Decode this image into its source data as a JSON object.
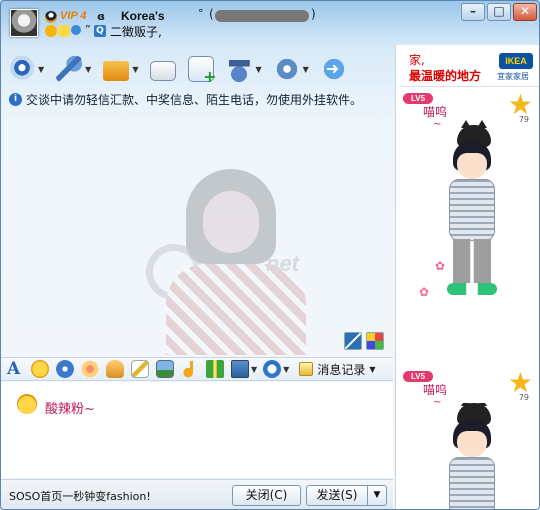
{
  "window": {
    "vip_label": "VIP 4",
    "contact_name": "Korea's",
    "name_symbol": "°",
    "qq_number_masked": "██████",
    "paren_open": "(",
    "paren_close": ")",
    "kb_glyph": "ɞ",
    "signature_quote": "”",
    "signature_icon_text": "Q",
    "signature": "二徵贩子,",
    "controls": {
      "minimize": "–",
      "maximize": "□",
      "close": "✕"
    }
  },
  "toolbar": {
    "items": [
      {
        "icon": "camera-icon"
      },
      {
        "icon": "microphone-icon"
      },
      {
        "icon": "folder-icon"
      },
      {
        "icon": "mail-icon"
      },
      {
        "icon": "add-document-icon"
      },
      {
        "icon": "graduation-cap-icon"
      },
      {
        "icon": "gear-icon"
      },
      {
        "icon": "share-arrow-icon"
      }
    ],
    "caret": "▼"
  },
  "notice": {
    "icon": "i",
    "text": "交谈中请勿轻信汇款、中奖信息、陌生电话，勿使用外挂软件。"
  },
  "history": {
    "ghost_brand": "net"
  },
  "format_bar": {
    "font_icon": "A",
    "caret": "▼",
    "message_log_label": "消息记录",
    "message_log_caret": "▼"
  },
  "input": {
    "text": "酸辣粉~"
  },
  "bottom": {
    "ad_text": "SOSO首页一秒钟变fashion!",
    "close_label": "关闭(C)",
    "send_label": "发送(S)",
    "send_arrow": "▼"
  },
  "ad": {
    "line1": "家,",
    "line2": "最温暖的地方",
    "brand": "IKEA",
    "brand_sub": "宜家家居"
  },
  "show": {
    "panels": [
      {
        "badge": "LV5",
        "bubble": "喵呜",
        "tilde": "~",
        "star": "★",
        "star_num": "79",
        "paw": "✿"
      },
      {
        "badge": "LV5",
        "bubble": "喵呜",
        "tilde": "~",
        "star": "★",
        "star_num": "79"
      }
    ]
  }
}
